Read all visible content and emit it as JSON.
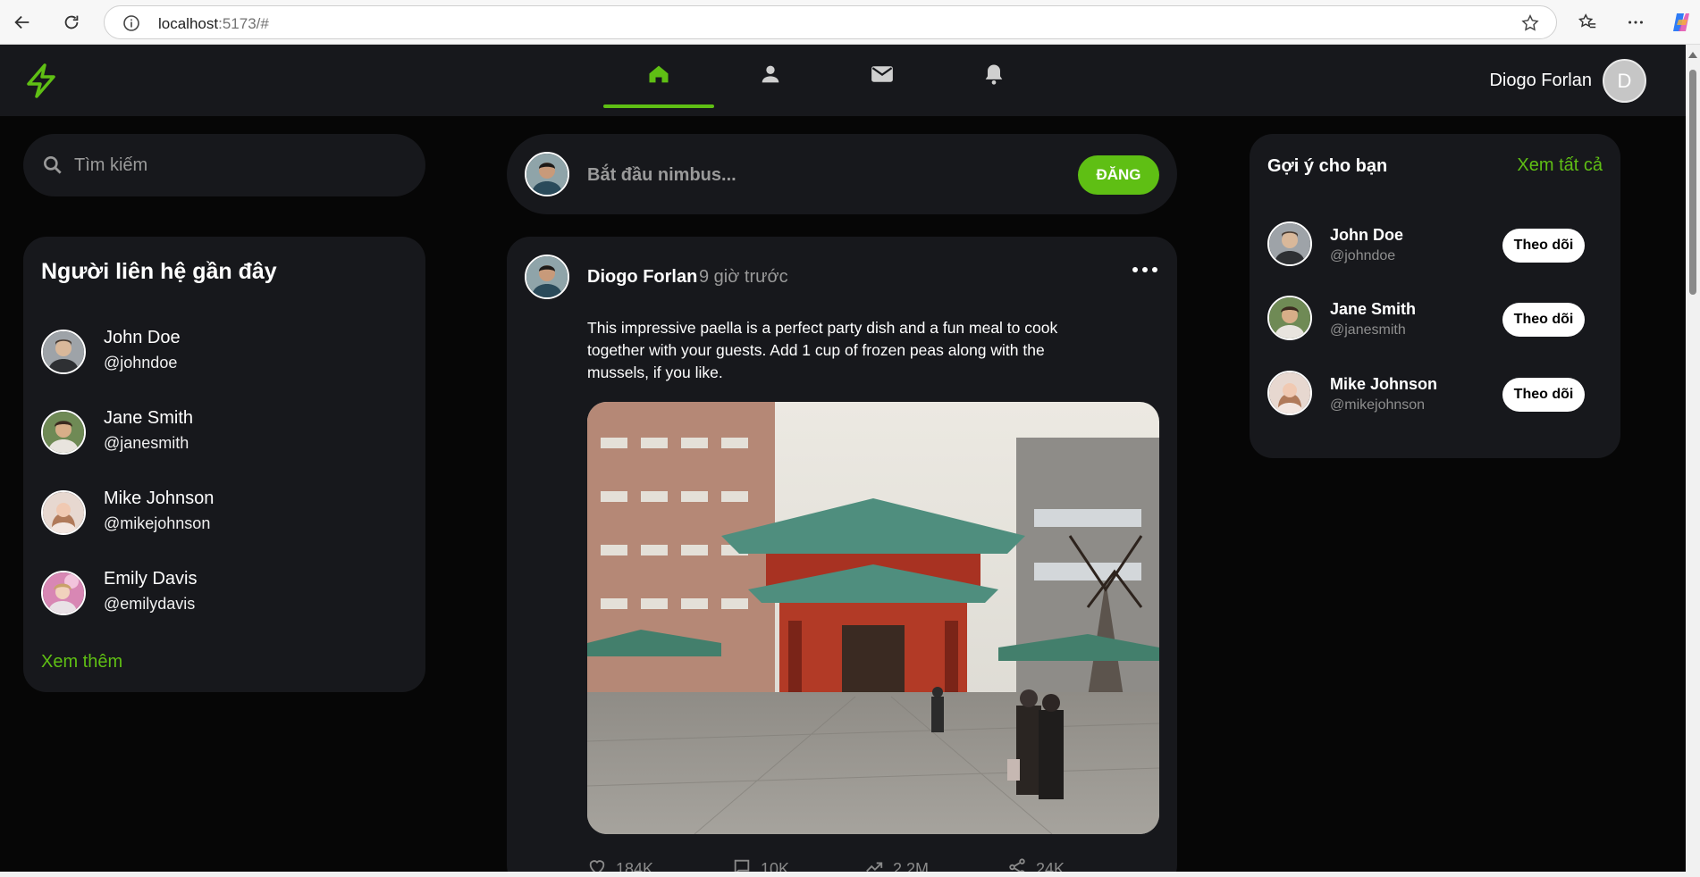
{
  "browser": {
    "url_host": "localhost",
    "url_rest": ":5173/#"
  },
  "header": {
    "user_name": "Diogo Forlan",
    "user_initial": "D",
    "nav": [
      "home-icon",
      "person-icon",
      "mail-icon",
      "bell-icon"
    ],
    "accent": "#5fbf14"
  },
  "search": {
    "placeholder": "Tìm kiếm"
  },
  "contacts": {
    "title": "Người liên hệ gần đây",
    "items": [
      {
        "name": "John Doe",
        "handle": "@johndoe"
      },
      {
        "name": "Jane Smith",
        "handle": "@janesmith"
      },
      {
        "name": "Mike Johnson",
        "handle": "@mikejohnson"
      },
      {
        "name": "Emily Davis",
        "handle": "@emilydavis"
      }
    ],
    "more": "Xem thêm"
  },
  "composer": {
    "placeholder": "Bắt đầu nimbus...",
    "post_label": "ĐĂNG"
  },
  "post": {
    "author": "Diogo Forlan",
    "time": "9 giờ trước",
    "text": "This impressive paella is a perfect party dish and a fun meal to cook together with your guests. Add 1 cup of frozen peas along with the mussels, if you like.",
    "stats": {
      "likes": "184K",
      "comments": "10K",
      "views": "2.2M",
      "shares": "24K"
    }
  },
  "suggestions": {
    "title": "Gợi ý cho bạn",
    "see_all": "Xem tất cả",
    "follow_label": "Theo dõi",
    "items": [
      {
        "name": "John Doe",
        "handle": "@johndoe"
      },
      {
        "name": "Jane Smith",
        "handle": "@janesmith"
      },
      {
        "name": "Mike Johnson",
        "handle": "@mikejohnson"
      }
    ]
  }
}
